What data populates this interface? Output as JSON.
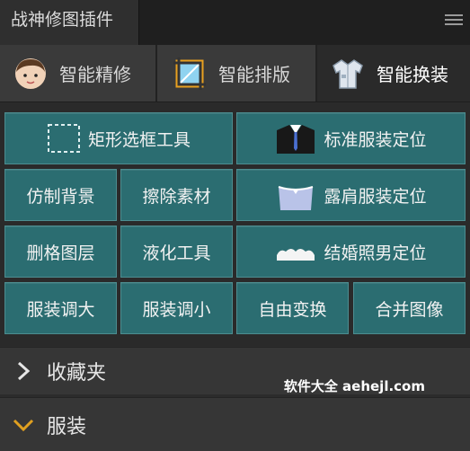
{
  "panel": {
    "tab_title": "战神修图插件"
  },
  "modes": [
    {
      "label": "智能精修"
    },
    {
      "label": "智能排版"
    },
    {
      "label": "智能换装"
    }
  ],
  "buttons": {
    "rect_tool": "矩形选框工具",
    "standard_pos": "标准服装定位",
    "copy_bg": "仿制背景",
    "erase": "擦除素材",
    "shoulder_pos": "露肩服装定位",
    "delete_layer": "删格图层",
    "liquify": "液化工具",
    "wedding_pos": "结婚照男定位",
    "enlarge": "服装调大",
    "shrink": "服装调小",
    "free_transform": "自由变换",
    "merge": "合并图像"
  },
  "accordion": {
    "favorites": "收藏夹",
    "clothing": "服装"
  },
  "watermark": "软件大全 aehejl.com",
  "colors": {
    "button": "#2b6d71",
    "accent": "#e0a020"
  }
}
